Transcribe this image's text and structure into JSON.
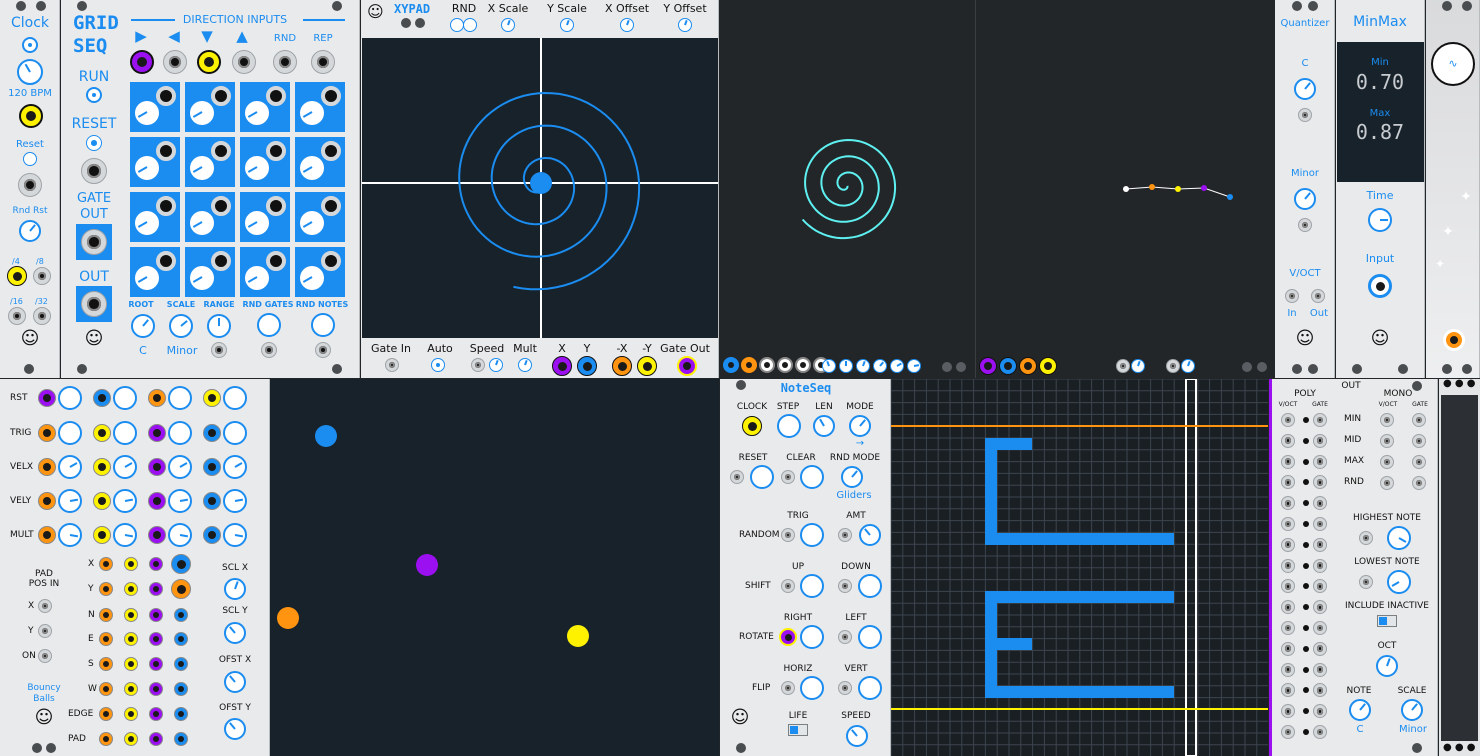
{
  "clock": {
    "title": "Clock",
    "bpm": "120 BPM",
    "reset": "Reset",
    "rnd_rst": "Rnd Rst",
    "d4": "/4",
    "d8": "/8",
    "d16": "/16",
    "d32": "/32"
  },
  "gridseq": {
    "title1": "GRID",
    "title2": "SEQ",
    "dir_inputs": "DIRECTION INPUTS",
    "arrows": [
      "▶",
      "◀",
      "▼",
      "▲"
    ],
    "rnd": "RND",
    "rep": "REP",
    "run": "RUN",
    "reset": "RESET",
    "gate1": "GATE",
    "gate2": "OUT",
    "out": "OUT",
    "root": "ROOT",
    "scale": "SCALE",
    "range": "RANGE",
    "rnd_gates": "RND GATES",
    "rnd_notes": "RND NOTES",
    "root_val": "C",
    "scale_val": "Minor"
  },
  "xypad": {
    "title": "XYPAD",
    "rnd": "RND",
    "x_scale": "X Scale",
    "y_scale": "Y Scale",
    "x_offset": "X Offset",
    "y_offset": "Y Offset",
    "gate_in": "Gate In",
    "auto": "Auto",
    "speed": "Speed",
    "mult": "Mult",
    "x": "X",
    "y": "Y",
    "nx": "-X",
    "ny": "-Y",
    "gate_out": "Gate Out"
  },
  "quantizer": {
    "title": "Quantizer",
    "root": "C",
    "scale": "Minor",
    "voct": "V/OCT",
    "in": "In",
    "out": "Out"
  },
  "minmax": {
    "title": "MinMax",
    "min_label": "Min",
    "min_val": "0.70",
    "max_label": "Max",
    "max_val": "0.87",
    "time": "Time",
    "input": "Input"
  },
  "bouncy": {
    "rst": "RST",
    "trig": "TRIG",
    "velx": "VELX",
    "vely": "VELY",
    "mult": "MULT",
    "pad_pos1": "PAD",
    "pad_pos2": "POS IN",
    "x": "X",
    "y": "Y",
    "on": "ON",
    "name1": "Bouncy",
    "name2": "Balls",
    "out_rows": [
      "X",
      "Y",
      "N",
      "E",
      "S",
      "W",
      "EDGE",
      "PAD"
    ],
    "scl_x": "SCL X",
    "scl_y": "SCL Y",
    "ofst_x": "OFST X",
    "ofst_y": "OFST Y"
  },
  "noteseq": {
    "title": "NoteSeq",
    "clock": "CLOCK",
    "step": "STEP",
    "len": "LEN",
    "mode": "MODE",
    "mode_arrow": "→",
    "reset": "RESET",
    "clear": "CLEAR",
    "rnd_mode": "RND MODE",
    "gliders": "Gliders",
    "trig": "TRIG",
    "amt": "AMT",
    "random": "RANDOM",
    "up": "UP",
    "down": "DOWN",
    "shift": "SHIFT",
    "right": "RIGHT",
    "left": "LEFT",
    "rotate": "ROTATE",
    "horiz": "HORIZ",
    "vert": "VERT",
    "flip": "FLIP",
    "life": "LIFE",
    "speed": "SPEED"
  },
  "noteseq_out": {
    "poly": "POLY",
    "out": "OUT",
    "mono": "MONO",
    "voct": "V/OCT",
    "gate": "GATE",
    "min": "MIN",
    "mid": "MID",
    "max": "MAX",
    "rnd": "RND",
    "highest": "HIGHEST NOTE",
    "lowest": "LOWEST NOTE",
    "include": "INCLUDE INACTIVE",
    "oct": "OCT",
    "note": "NOTE",
    "scale": "SCALE",
    "note_val": "C",
    "scale_val": "Minor"
  },
  "colors": {
    "accent": "#1b8cf0",
    "panel": "#e9eaeb",
    "screen": "#17222a",
    "purple": "#9b10f0",
    "yellow": "#fff200",
    "orange": "#ff9410",
    "cyan": "#5ef0f0"
  }
}
